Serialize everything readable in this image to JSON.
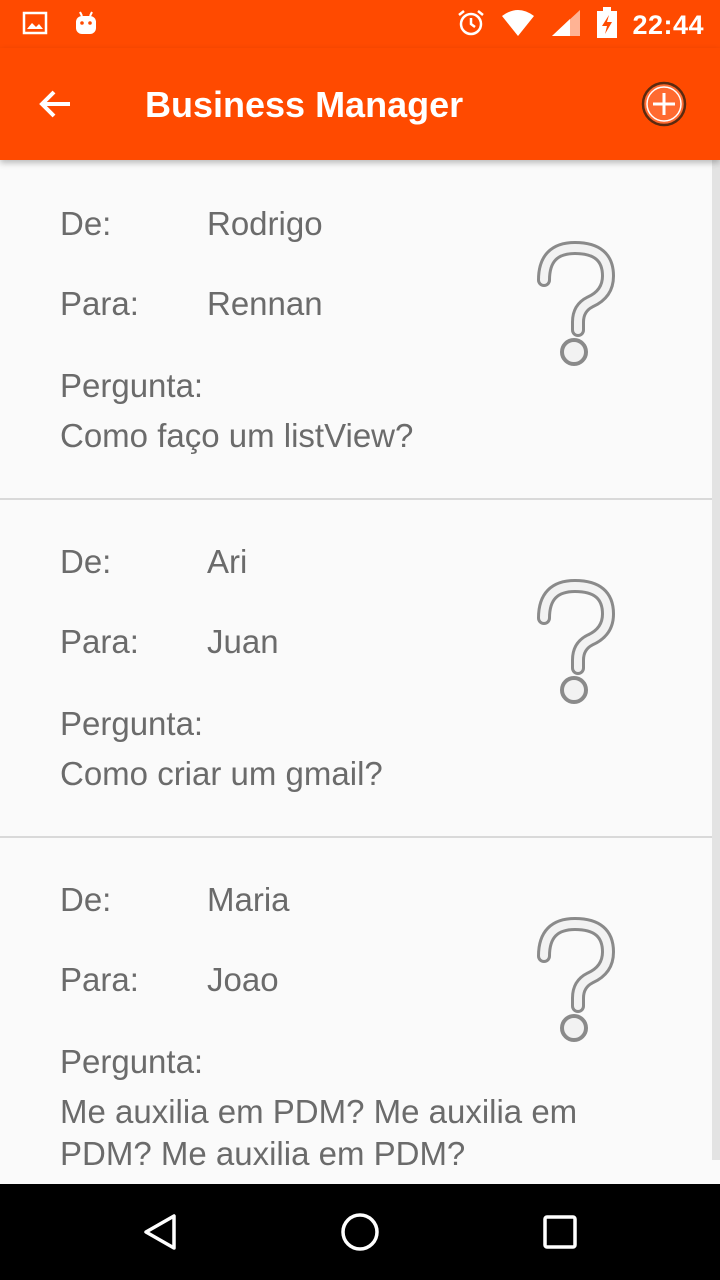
{
  "status_bar": {
    "time": "22:44",
    "left_icons": [
      "image-icon",
      "android-icon"
    ],
    "right_icons": [
      "alarm-icon",
      "wifi-icon",
      "signal-icon",
      "battery-charging-icon"
    ]
  },
  "toolbar": {
    "title": "Business Manager",
    "back_icon": "arrow-back-icon",
    "add_icon": "add-circle-icon"
  },
  "labels": {
    "de": "De:",
    "para": "Para:",
    "pergunta": "Pergunta:"
  },
  "items": [
    {
      "de": "Rodrigo",
      "para": "Rennan",
      "pergunta": "Como faço um listView?"
    },
    {
      "de": "Ari",
      "para": "Juan",
      "pergunta": "Como criar um gmail?"
    },
    {
      "de": "Maria",
      "para": "Joao",
      "pergunta": "Me auxilia em PDM? Me auxilia em PDM? Me auxilia em PDM?"
    }
  ],
  "colors": {
    "accent": "#ff4a00",
    "text": "#6b6b6b",
    "background": "#fafafa"
  }
}
